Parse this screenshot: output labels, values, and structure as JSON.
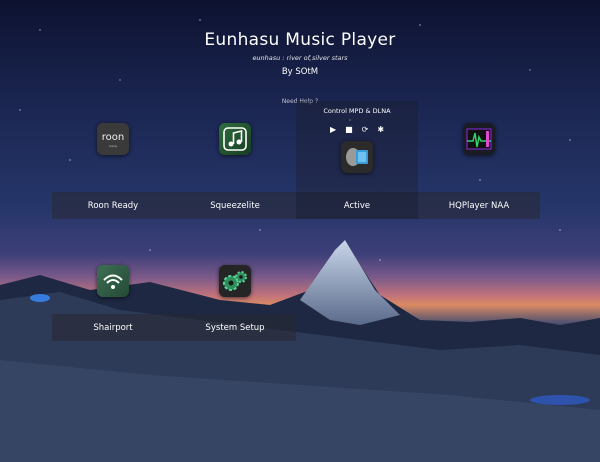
{
  "header": {
    "title": "Eunhasu Music Player",
    "subtitle": "eunhasu : river of silver stars",
    "byline": "By SOtM",
    "help": "Need Help ?"
  },
  "active_tile": {
    "controls_title": "Control MPD & DLNA",
    "controls": [
      "play",
      "stop",
      "refresh",
      "settings"
    ]
  },
  "tiles": [
    {
      "label": "Roon Ready",
      "icon": "roon-icon",
      "icon_text": "roon"
    },
    {
      "label": "Squeezelite",
      "icon": "music-note-icon"
    },
    {
      "label": "Active",
      "icon": "mpd-speaker-icon"
    },
    {
      "label": "HQPlayer NAA",
      "icon": "hqplayer-icon"
    },
    {
      "label": "Shairport",
      "icon": "wifi-icon"
    },
    {
      "label": "System Setup",
      "icon": "gears-icon"
    }
  ],
  "colors": {
    "accent_green": "#2fd16b",
    "tile_overlay": "#28283280"
  }
}
